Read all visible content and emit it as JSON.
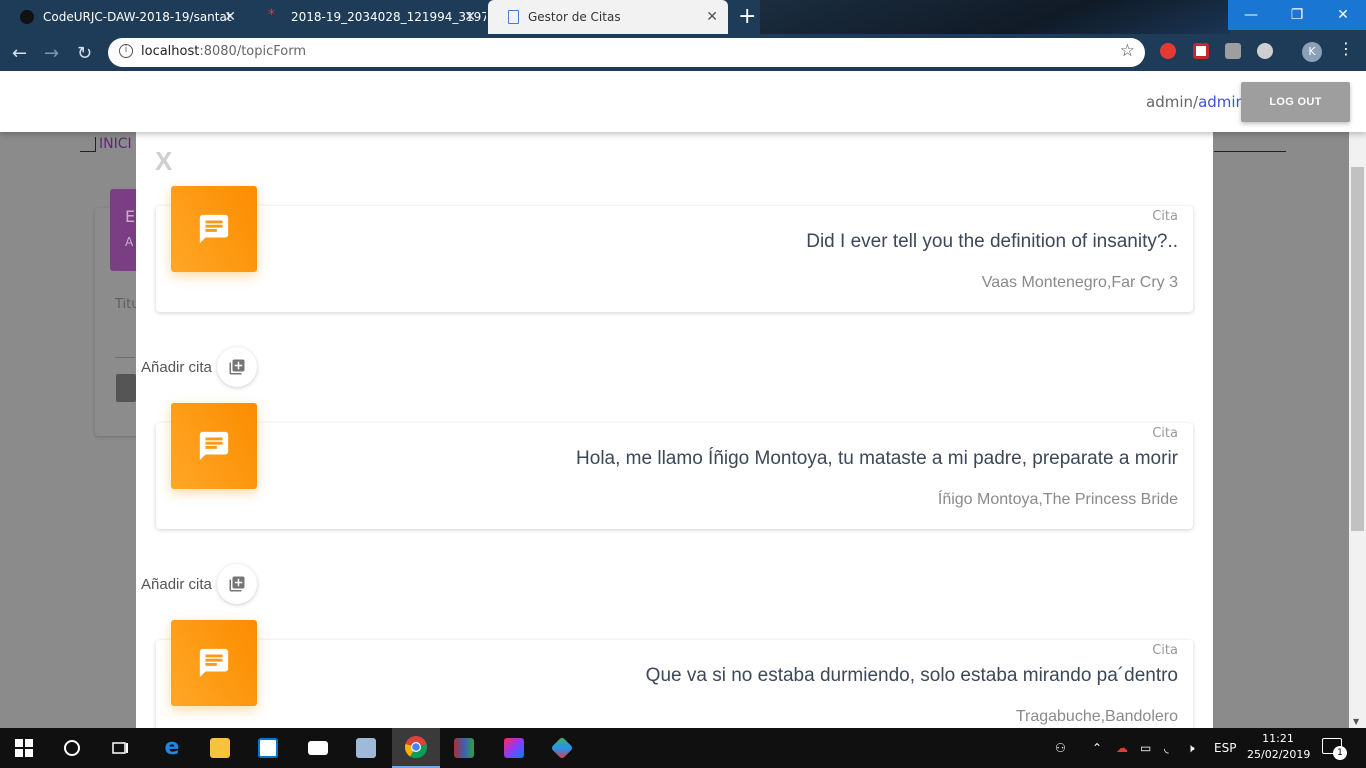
{
  "browser": {
    "tabs": [
      {
        "label": "CodeURJC-DAW-2018-19/santat"
      },
      {
        "label": "2018-19_2034028_121994_3197"
      },
      {
        "label": "Gestor de Citas"
      }
    ],
    "url_host": "localhost",
    "url_rest": ":8080/topicForm",
    "profile_initial": "K"
  },
  "header": {
    "username": "admin",
    "separator": "/",
    "role": "admin",
    "logout_label": "LOG OUT"
  },
  "background": {
    "nav_text": "INICI",
    "card_title": "E",
    "card_subtitle": "A",
    "field_label": "Titu"
  },
  "modal": {
    "close_label": "X",
    "quotes": [
      {
        "kind": "Cita",
        "text": "Did I ever tell you the definition of insanity?..",
        "author": "Vaas Montenegro,Far Cry 3"
      },
      {
        "kind": "Cita",
        "text": "Hola, me llamo Íñigo Montoya, tu mataste a mi padre, preparate a morir",
        "author": "Íñigo Montoya,The Princess Bride"
      },
      {
        "kind": "Cita",
        "text": "Que va si no estaba durmiendo, solo estaba mirando pa´dentro",
        "author": "Tragabuche,Bandolero"
      }
    ],
    "add_label": "Añadir cita"
  },
  "taskbar": {
    "language": "ESP",
    "time": "11:21",
    "date": "25/02/2019",
    "notification_count": "1"
  },
  "colors": {
    "accent_orange": "#fb8c00",
    "link_blue": "#3f51d8",
    "titlebar_blue": "#1976d2"
  }
}
